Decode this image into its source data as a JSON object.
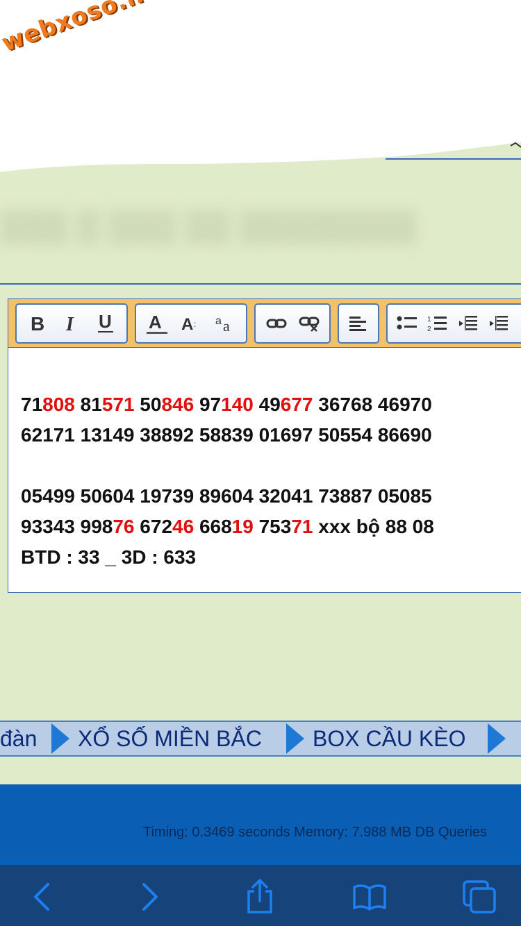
{
  "watermark": "webxoso.net",
  "blurred_title": "▒▒▒ ▒ ▒▒▒ ▒▒ ▒▒▒▒▒▒▒▒▒",
  "toolbar": {
    "groups": [
      {
        "name": "text-style",
        "buttons": [
          "bold-icon",
          "italic-icon",
          "underline-icon"
        ]
      },
      {
        "name": "font",
        "buttons": [
          "font-color-icon",
          "font-size-icon",
          "font-case-icon"
        ]
      },
      {
        "name": "links",
        "buttons": [
          "link-icon",
          "unlink-icon"
        ]
      },
      {
        "name": "align",
        "buttons": [
          "align-left-icon"
        ]
      },
      {
        "name": "lists",
        "buttons": [
          "bullet-list-icon",
          "numbered-list-icon",
          "outdent-icon",
          "indent-icon"
        ]
      }
    ]
  },
  "content": {
    "lines": [
      [
        {
          "t": "71",
          "red": false
        },
        {
          "t": "808",
          "red": true
        },
        {
          "t": " 81",
          "red": false
        },
        {
          "t": "571",
          "red": true
        },
        {
          "t": " 50",
          "red": false
        },
        {
          "t": "846",
          "red": true
        },
        {
          "t": " 97",
          "red": false
        },
        {
          "t": "140",
          "red": true
        },
        {
          "t": " 49",
          "red": false
        },
        {
          "t": "677",
          "red": true
        },
        {
          "t": " 36768 46970",
          "red": false
        }
      ],
      [
        {
          "t": "62171 13149 38892 58839 01697 50554 86690",
          "red": false
        }
      ],
      [
        {
          "t": "",
          "red": false
        }
      ],
      [
        {
          "t": "05499 50604 19739 89604 32041 73887 05085",
          "red": false
        }
      ],
      [
        {
          "t": "93343 998",
          "red": false
        },
        {
          "t": "76",
          "red": true
        },
        {
          "t": " 672",
          "red": false
        },
        {
          "t": "46",
          "red": true
        },
        {
          "t": " 668",
          "red": false
        },
        {
          "t": "19",
          "red": true
        },
        {
          "t": " 753",
          "red": false
        },
        {
          "t": "71",
          "red": true
        },
        {
          "t": " xxx bộ 88 08",
          "red": false
        }
      ],
      [
        {
          "t": "BTD : 33 _ 3D : 633",
          "red": false
        }
      ]
    ]
  },
  "nav": {
    "items": [
      "đàn",
      "XỔ SỐ MIỀN BẮC",
      "BOX CẦU KÈO"
    ]
  },
  "footer": {
    "timing": "Timing: 0.3469 seconds Memory: 7.988 MB DB Queries"
  },
  "safari": {
    "buttons": [
      "back-icon",
      "forward-icon",
      "share-icon",
      "bookmarks-icon",
      "tabs-icon"
    ]
  },
  "colors": {
    "page_bg": "#e0ebca",
    "highlight_red": "#e01010",
    "nav_text": "#0b2a7a",
    "footer_bg": "#0a5fb5",
    "safari_bar": "#16437a",
    "watermark": "#f07a1e"
  }
}
